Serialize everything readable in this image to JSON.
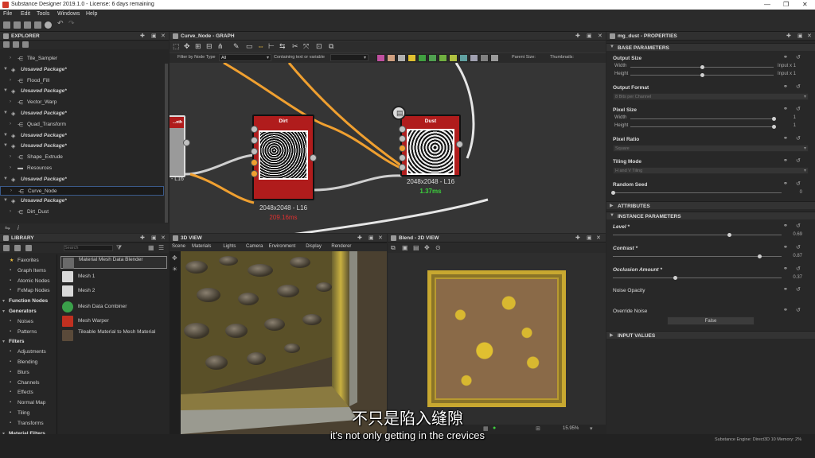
{
  "window": {
    "title": "Substance Designer 2019.1.0 - License: 6 days remaining"
  },
  "menu": [
    "File",
    "Edit",
    "Tools",
    "Windows",
    "Help"
  ],
  "explorer": {
    "title": "EXPLORER",
    "items": [
      {
        "label": "Tile_Sampler",
        "type": "graph"
      },
      {
        "label": "Unsaved Package*",
        "type": "package"
      },
      {
        "label": "Flood_Fill",
        "type": "graph"
      },
      {
        "label": "Unsaved Package*",
        "type": "package"
      },
      {
        "label": "Vector_Warp",
        "type": "graph"
      },
      {
        "label": "Unsaved Package*",
        "type": "package"
      },
      {
        "label": "Quad_Transform",
        "type": "graph"
      },
      {
        "label": "Unsaved Package*",
        "type": "package"
      },
      {
        "label": "Unsaved Package*",
        "type": "package"
      },
      {
        "label": "Shape_Extrude",
        "type": "graph"
      },
      {
        "label": "Resources",
        "type": "folder"
      },
      {
        "label": "Unsaved Package*",
        "type": "package"
      },
      {
        "label": "Curve_Node",
        "type": "graph",
        "selected": true
      },
      {
        "label": "Unsaved Package*",
        "type": "package"
      },
      {
        "label": "Dirt_Dust",
        "type": "graph"
      }
    ]
  },
  "library": {
    "title": "LIBRARY",
    "search_placeholder": "Search",
    "categories": [
      {
        "label": "Favorites",
        "bold": false
      },
      {
        "label": "Graph Items",
        "bold": false
      },
      {
        "label": "Atomic Nodes",
        "bold": false
      },
      {
        "label": "FxMap Nodes",
        "bold": false
      },
      {
        "label": "Function Nodes",
        "bold": true
      },
      {
        "label": "Generators",
        "bold": true
      },
      {
        "label": "Noises",
        "bold": false
      },
      {
        "label": "Patterns",
        "bold": false
      },
      {
        "label": "Filters",
        "bold": true
      },
      {
        "label": "Adjustments",
        "bold": false
      },
      {
        "label": "Blending",
        "bold": false
      },
      {
        "label": "Blurs",
        "bold": false
      },
      {
        "label": "Channels",
        "bold": false
      },
      {
        "label": "Effects",
        "bold": false
      },
      {
        "label": "Normal Map",
        "bold": false
      },
      {
        "label": "Tiling",
        "bold": false
      },
      {
        "label": "Transforms",
        "bold": false
      },
      {
        "label": "Material Filters",
        "bold": true
      }
    ],
    "items": [
      {
        "label": "Material Mesh Data Blender"
      },
      {
        "label": "Mesh 1"
      },
      {
        "label": "Mesh 2"
      },
      {
        "label": "Mesh Data Combiner"
      },
      {
        "label": "Mesh Warper"
      },
      {
        "label": "Tileable Material to Mesh Material"
      }
    ]
  },
  "graph": {
    "tab": "Curve_Node - GRAPH",
    "filter_label": "Filter by Node Type",
    "filter_value": "All",
    "contains_label": "Containing text or variable",
    "parent_size_label": "Parent Size:",
    "thumbnails_label": "Thumbnails:",
    "nodes": [
      {
        "name": "left",
        "title": "...nth",
        "info": "- L16",
        "time": ""
      },
      {
        "name": "dirt",
        "title": "Dirt",
        "info": "2048x2048 - L16",
        "time": "209.16ms"
      },
      {
        "name": "dust",
        "title": "Dust",
        "info": "2048x2048 - L16",
        "time": "1.37ms"
      }
    ]
  },
  "view3d": {
    "tab": "3D VIEW",
    "menu": [
      "Scene",
      "Materials",
      "Lights",
      "Camera",
      "Environment",
      "Display",
      "Renderer"
    ]
  },
  "view2d": {
    "tab": "Blend - 2D VIEW",
    "zoom": "15.95%"
  },
  "properties": {
    "tab": "mg_dust - PROPERTIES",
    "base_section": "BASE PARAMETERS",
    "output_size": {
      "label": "Output Size",
      "width_label": "Width",
      "height_label": "Height",
      "width_val": "Input x 1",
      "height_val": "Input x 1",
      "width": 0.5,
      "height": 0.5
    },
    "output_format": {
      "label": "Output Format",
      "value": "8 Bits per Channel"
    },
    "pixel_size": {
      "label": "Pixel Size",
      "width_label": "Width",
      "height_label": "Height",
      "width_val": "1",
      "height_val": "1",
      "width": 1.0,
      "height": 1.0
    },
    "pixel_ratio": {
      "label": "Pixel Ratio",
      "value": "Square"
    },
    "tiling_mode": {
      "label": "Tiling Mode",
      "value": "H and V Tiling"
    },
    "random_seed": {
      "label": "Random Seed",
      "value": "0",
      "level": 0
    },
    "attributes_section": "ATTRIBUTES",
    "instance_section": "INSTANCE PARAMETERS",
    "level": {
      "label": "Level *",
      "value": "0.69",
      "level": 0.69
    },
    "contrast": {
      "label": "Contrast *",
      "value": "0.87",
      "level": 0.87
    },
    "occlusion": {
      "label": "Occlusion Amount *",
      "value": "0.37",
      "level": 0.37
    },
    "noise_opacity": {
      "label": "Noise Opacity"
    },
    "override_noise": {
      "label": "Override Noise",
      "value": "False"
    },
    "input_section": "INPUT VALUES"
  },
  "status": {
    "engine": "Substance Engine: Direct3D 10  Memory: 2%"
  },
  "subtitles": {
    "zh": "不只是陷入缝隙",
    "en": "it's not only getting in the crevices"
  },
  "colors": {
    "accent": "#b01c1c",
    "wire": "#f0a030",
    "time_good": "#3cd13c",
    "time_bad": "#e03030"
  }
}
